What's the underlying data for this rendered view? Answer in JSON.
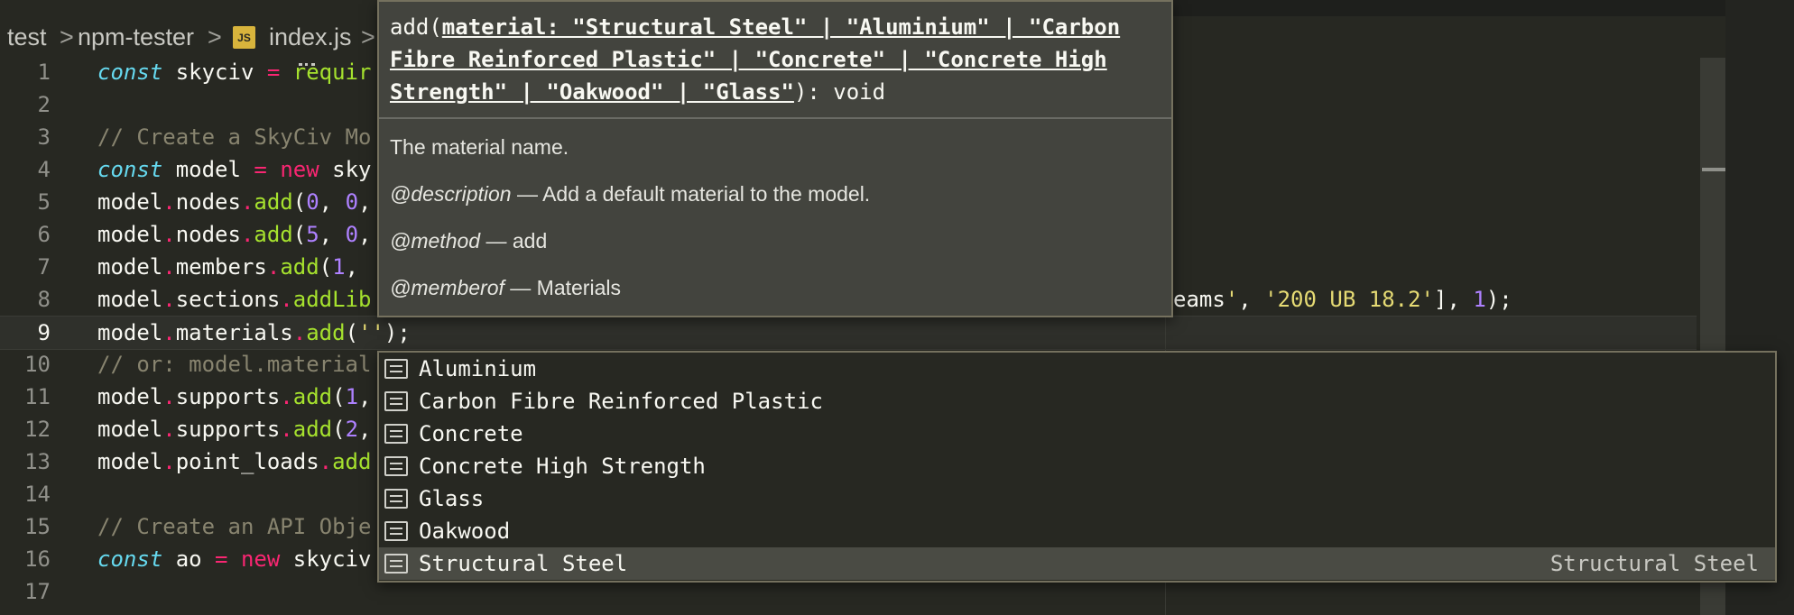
{
  "breadcrumb": {
    "items": [
      "test",
      "npm-tester",
      "index.js"
    ],
    "separator": ">",
    "file_badge": "JS"
  },
  "editor": {
    "lines": [
      {
        "num": "1",
        "tokens": [
          [
            "storage",
            "const"
          ],
          [
            "plain",
            " skyciv "
          ],
          [
            "punct",
            "="
          ],
          [
            "plain",
            " "
          ],
          [
            "func",
            "requir"
          ]
        ]
      },
      {
        "num": "2",
        "tokens": []
      },
      {
        "num": "3",
        "tokens": [
          [
            "comment",
            "// Create a SkyCiv Mo"
          ]
        ]
      },
      {
        "num": "4",
        "tokens": [
          [
            "storage",
            "const"
          ],
          [
            "plain",
            " model "
          ],
          [
            "punct",
            "="
          ],
          [
            "plain",
            " "
          ],
          [
            "keyword",
            "new"
          ],
          [
            "plain",
            " sky"
          ]
        ]
      },
      {
        "num": "5",
        "tokens": [
          [
            "plain",
            "model"
          ],
          [
            "punct",
            "."
          ],
          [
            "plain",
            "nodes"
          ],
          [
            "punct",
            "."
          ],
          [
            "func",
            "add"
          ],
          [
            "plain",
            "("
          ],
          [
            "num",
            "0"
          ],
          [
            "plain",
            ", "
          ],
          [
            "num",
            "0"
          ],
          [
            "plain",
            ","
          ]
        ]
      },
      {
        "num": "6",
        "tokens": [
          [
            "plain",
            "model"
          ],
          [
            "punct",
            "."
          ],
          [
            "plain",
            "nodes"
          ],
          [
            "punct",
            "."
          ],
          [
            "func",
            "add"
          ],
          [
            "plain",
            "("
          ],
          [
            "num",
            "5"
          ],
          [
            "plain",
            ", "
          ],
          [
            "num",
            "0"
          ],
          [
            "plain",
            ","
          ]
        ]
      },
      {
        "num": "7",
        "tokens": [
          [
            "plain",
            "model"
          ],
          [
            "punct",
            "."
          ],
          [
            "plain",
            "members"
          ],
          [
            "punct",
            "."
          ],
          [
            "func",
            "add"
          ],
          [
            "plain",
            "("
          ],
          [
            "num",
            "1"
          ],
          [
            "plain",
            ","
          ]
        ]
      },
      {
        "num": "8",
        "tokens": [
          [
            "plain",
            "model"
          ],
          [
            "punct",
            "."
          ],
          [
            "plain",
            "sections"
          ],
          [
            "punct",
            "."
          ],
          [
            "func",
            "addLib"
          ]
        ]
      },
      {
        "num": "9",
        "tokens": [
          [
            "plain",
            "model"
          ],
          [
            "punct",
            "."
          ],
          [
            "plain",
            "materials"
          ],
          [
            "punct",
            "."
          ],
          [
            "func",
            "add"
          ],
          [
            "plain",
            "("
          ],
          [
            "str",
            "''"
          ],
          [
            "plain",
            ");"
          ]
        ]
      },
      {
        "num": "10",
        "tokens": [
          [
            "comment",
            "// or: model.material"
          ]
        ]
      },
      {
        "num": "11",
        "tokens": [
          [
            "plain",
            "model"
          ],
          [
            "punct",
            "."
          ],
          [
            "plain",
            "supports"
          ],
          [
            "punct",
            "."
          ],
          [
            "func",
            "add"
          ],
          [
            "plain",
            "("
          ],
          [
            "num",
            "1"
          ],
          [
            "plain",
            ","
          ]
        ]
      },
      {
        "num": "12",
        "tokens": [
          [
            "plain",
            "model"
          ],
          [
            "punct",
            "."
          ],
          [
            "plain",
            "supports"
          ],
          [
            "punct",
            "."
          ],
          [
            "func",
            "add"
          ],
          [
            "plain",
            "("
          ],
          [
            "num",
            "2"
          ],
          [
            "plain",
            ","
          ]
        ]
      },
      {
        "num": "13",
        "tokens": [
          [
            "plain",
            "model"
          ],
          [
            "punct",
            "."
          ],
          [
            "plain",
            "point_loads"
          ],
          [
            "punct",
            "."
          ],
          [
            "func",
            "add"
          ]
        ]
      },
      {
        "num": "14",
        "tokens": []
      },
      {
        "num": "15",
        "tokens": [
          [
            "comment",
            "// Create an API Obje"
          ]
        ]
      },
      {
        "num": "16",
        "tokens": [
          [
            "storage",
            "const"
          ],
          [
            "plain",
            " ao "
          ],
          [
            "punct",
            "="
          ],
          [
            "plain",
            " "
          ],
          [
            "keyword",
            "new"
          ],
          [
            "plain",
            " skyciv"
          ]
        ]
      },
      {
        "num": "17",
        "tokens": []
      }
    ],
    "line8_tail": [
      [
        "plain",
        "eams"
      ],
      [
        "str",
        "'"
      ],
      [
        "plain",
        ", "
      ],
      [
        "str",
        "'200 UB 18.2'"
      ],
      [
        "plain",
        "], "
      ],
      [
        "num",
        "1"
      ],
      [
        "plain",
        ");"
      ]
    ],
    "current_line": "9"
  },
  "hover": {
    "sig_prefix": "add(",
    "sig_param": "material: \"Structural Steel\" | \"Aluminium\" | \"Carbon Fibre Reinforced Plastic\" | \"Concrete\" | \"Concrete High Strength\" | \"Oakwood\" | \"Glass\"",
    "sig_suffix": "): void",
    "param_doc": "The material name.",
    "tags": [
      {
        "tag": "@description",
        "text": " — Add a default material to the model."
      },
      {
        "tag": "@method",
        "text": " — add"
      },
      {
        "tag": "@memberof",
        "text": " — Materials"
      }
    ]
  },
  "suggest": {
    "items": [
      {
        "label": "Aluminium",
        "icon": "text-icon"
      },
      {
        "label": "Carbon Fibre Reinforced Plastic",
        "icon": "text-icon"
      },
      {
        "label": "Concrete",
        "icon": "text-icon"
      },
      {
        "label": "Concrete High Strength",
        "icon": "text-icon"
      },
      {
        "label": "Glass",
        "icon": "text-icon"
      },
      {
        "label": "Oakwood",
        "icon": "text-icon"
      },
      {
        "label": "Structural Steel",
        "icon": "text-icon",
        "selected": true,
        "detail": "Structural Steel"
      }
    ]
  },
  "colors": {
    "background": "#272822",
    "storage": "#66d9ef",
    "keyword": "#f92672",
    "function": "#a6e22e",
    "number": "#ae81ff",
    "string": "#e6db74",
    "comment": "#88846f"
  }
}
